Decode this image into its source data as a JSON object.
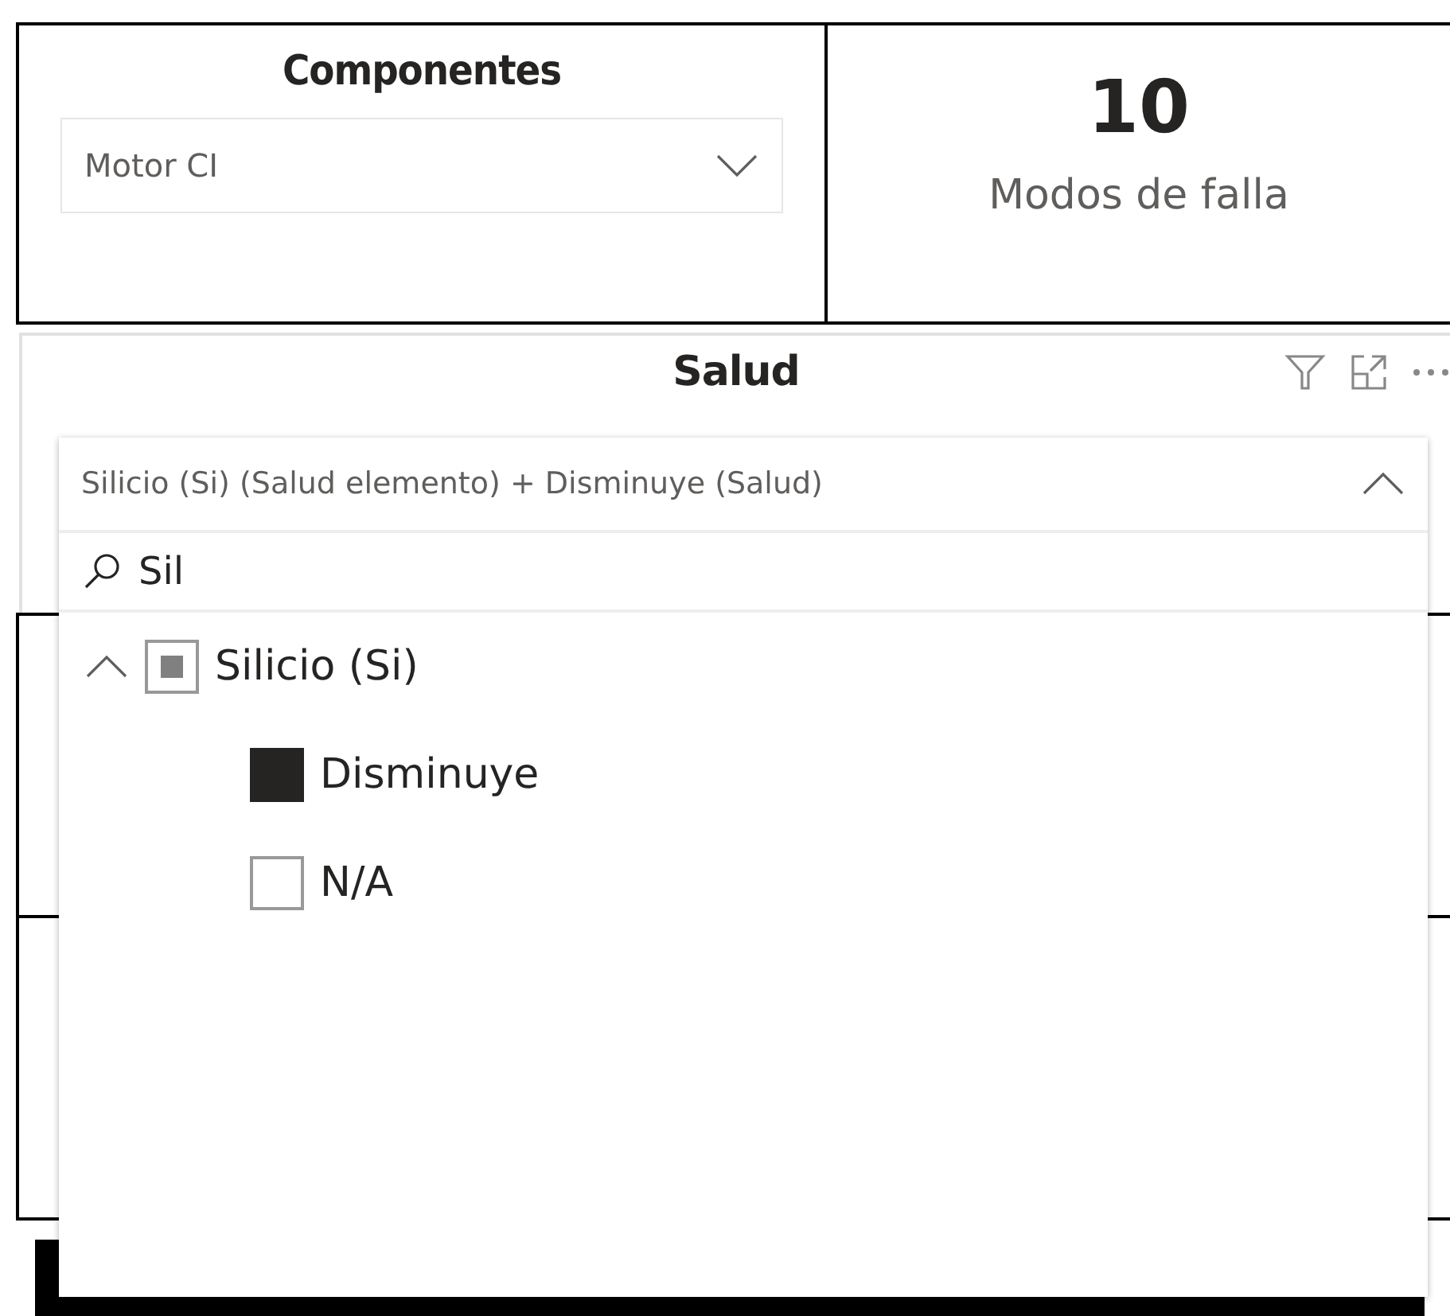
{
  "component_slicer": {
    "title": "Componentes",
    "value": "Motor CI"
  },
  "card": {
    "value": "10",
    "label": "Modos de falla"
  },
  "salud_slicer": {
    "title": "Salud",
    "selection": "Silicio (Si) (Salud elemento) + Disminuye (Salud)",
    "expanded": true,
    "search": "Sil",
    "tree": [
      {
        "label": "Silicio (Si)",
        "expanded": true,
        "partial": true,
        "children": [
          {
            "label": "Disminuye",
            "checked": true
          },
          {
            "label": "N/A",
            "checked": false
          }
        ]
      }
    ]
  }
}
